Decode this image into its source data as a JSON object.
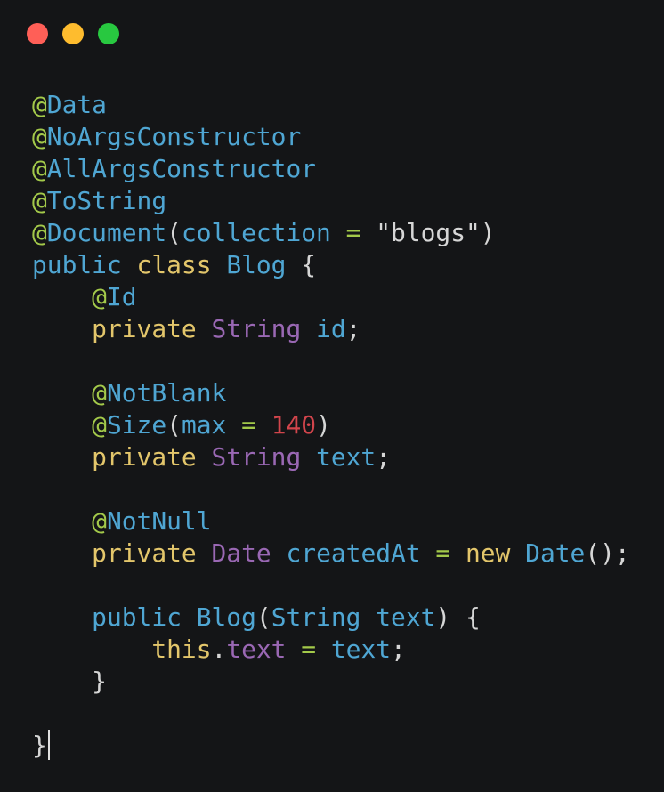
{
  "window": {
    "controls": [
      {
        "name": "close",
        "color": "#ff5f57"
      },
      {
        "name": "minimize",
        "color": "#febc2e"
      },
      {
        "name": "maximize",
        "color": "#28c840"
      }
    ]
  },
  "colors": {
    "background": "#141517",
    "at": "#a3c94a",
    "blue": "#4fa6d3",
    "yellow": "#e3c66b",
    "purple": "#9a68b4",
    "red": "#d2454c",
    "green": "#a3c94a",
    "plain": "#d6d6d6"
  },
  "code": {
    "language": "java",
    "lines": [
      [
        [
          "@",
          "at"
        ],
        [
          "Data",
          "blue"
        ]
      ],
      [
        [
          "@",
          "at"
        ],
        [
          "NoArgsConstructor",
          "blue"
        ]
      ],
      [
        [
          "@",
          "at"
        ],
        [
          "AllArgsConstructor",
          "blue"
        ]
      ],
      [
        [
          "@",
          "at"
        ],
        [
          "ToString",
          "blue"
        ]
      ],
      [
        [
          "@",
          "at"
        ],
        [
          "Document",
          "blue"
        ],
        [
          "(",
          "plain"
        ],
        [
          "collection",
          "blue"
        ],
        [
          " ",
          "plain"
        ],
        [
          "=",
          "green"
        ],
        [
          " ",
          "plain"
        ],
        [
          "\"blogs\"",
          "plain"
        ],
        [
          ")",
          "plain"
        ]
      ],
      [
        [
          "public",
          "blue"
        ],
        [
          " ",
          "plain"
        ],
        [
          "class",
          "yellow"
        ],
        [
          " ",
          "plain"
        ],
        [
          "Blog",
          "blue"
        ],
        [
          " {",
          "plain"
        ]
      ],
      [
        [
          "    ",
          "plain"
        ],
        [
          "@",
          "at"
        ],
        [
          "Id",
          "blue"
        ]
      ],
      [
        [
          "    ",
          "plain"
        ],
        [
          "private",
          "yellow"
        ],
        [
          " ",
          "plain"
        ],
        [
          "String",
          "purple"
        ],
        [
          " ",
          "plain"
        ],
        [
          "id",
          "blue"
        ],
        [
          ";",
          "plain"
        ]
      ],
      [],
      [
        [
          "    ",
          "plain"
        ],
        [
          "@",
          "at"
        ],
        [
          "NotBlank",
          "blue"
        ]
      ],
      [
        [
          "    ",
          "plain"
        ],
        [
          "@",
          "at"
        ],
        [
          "Size",
          "blue"
        ],
        [
          "(",
          "plain"
        ],
        [
          "max",
          "blue"
        ],
        [
          " ",
          "plain"
        ],
        [
          "=",
          "green"
        ],
        [
          " ",
          "plain"
        ],
        [
          "140",
          "red"
        ],
        [
          ")",
          "plain"
        ]
      ],
      [
        [
          "    ",
          "plain"
        ],
        [
          "private",
          "yellow"
        ],
        [
          " ",
          "plain"
        ],
        [
          "String",
          "purple"
        ],
        [
          " ",
          "plain"
        ],
        [
          "text",
          "blue"
        ],
        [
          ";",
          "plain"
        ]
      ],
      [],
      [
        [
          "    ",
          "plain"
        ],
        [
          "@",
          "at"
        ],
        [
          "NotNull",
          "blue"
        ]
      ],
      [
        [
          "    ",
          "plain"
        ],
        [
          "private",
          "yellow"
        ],
        [
          " ",
          "plain"
        ],
        [
          "Date",
          "purple"
        ],
        [
          " ",
          "plain"
        ],
        [
          "createdAt",
          "blue"
        ],
        [
          " ",
          "plain"
        ],
        [
          "=",
          "green"
        ],
        [
          " ",
          "plain"
        ],
        [
          "new",
          "yellow"
        ],
        [
          " ",
          "plain"
        ],
        [
          "Date",
          "blue"
        ],
        [
          "();",
          "plain"
        ]
      ],
      [],
      [
        [
          "    ",
          "plain"
        ],
        [
          "public",
          "blue"
        ],
        [
          " ",
          "plain"
        ],
        [
          "Blog",
          "blue"
        ],
        [
          "(",
          "plain"
        ],
        [
          "String",
          "blue"
        ],
        [
          " ",
          "plain"
        ],
        [
          "text",
          "blue"
        ],
        [
          ") {",
          "plain"
        ]
      ],
      [
        [
          "        ",
          "plain"
        ],
        [
          "this",
          "yellow"
        ],
        [
          ".",
          "plain"
        ],
        [
          "text",
          "purple"
        ],
        [
          " ",
          "plain"
        ],
        [
          "=",
          "green"
        ],
        [
          " ",
          "plain"
        ],
        [
          "text",
          "blue"
        ],
        [
          ";",
          "plain"
        ]
      ],
      [
        [
          "    ",
          "plain"
        ],
        [
          "}",
          "plain"
        ]
      ],
      [],
      [
        [
          "}",
          "plain"
        ]
      ]
    ],
    "cursor_line": 21
  }
}
